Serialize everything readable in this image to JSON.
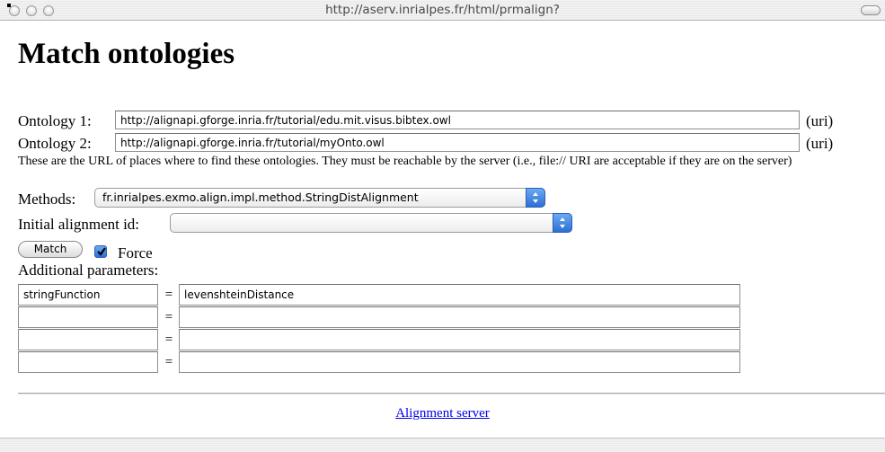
{
  "window": {
    "url": "http://aserv.inrialpes.fr/html/prmalign?"
  },
  "page": {
    "title": "Match ontologies",
    "ontology1": {
      "label": "Ontology 1:",
      "value": "http://alignapi.gforge.inria.fr/tutorial/edu.mit.visus.bibtex.owl",
      "suffix": "(uri)"
    },
    "ontology2": {
      "label": "Ontology 2:",
      "value": "http://alignapi.gforge.inria.fr/tutorial/myOnto.owl",
      "suffix": "(uri)"
    },
    "help_text": "These are the URL of places where to find these ontologies. They must be reachable by the server (i.e., file:// URI are acceptable if they are on the server)",
    "methods": {
      "label": "Methods:",
      "selected": "fr.inrialpes.exmo.align.impl.method.StringDistAlignment"
    },
    "initial_alignment": {
      "label": "Initial alignment id:",
      "selected": ""
    },
    "match_button": "Match",
    "force": {
      "label": "Force",
      "checked": true
    },
    "additional_parameters": {
      "label": "Additional parameters:",
      "equals": "=",
      "rows": [
        {
          "name": "stringFunction",
          "value": "levenshteinDistance"
        },
        {
          "name": "",
          "value": ""
        },
        {
          "name": "",
          "value": ""
        },
        {
          "name": "",
          "value": ""
        }
      ]
    },
    "footer_link": "Alignment server"
  }
}
